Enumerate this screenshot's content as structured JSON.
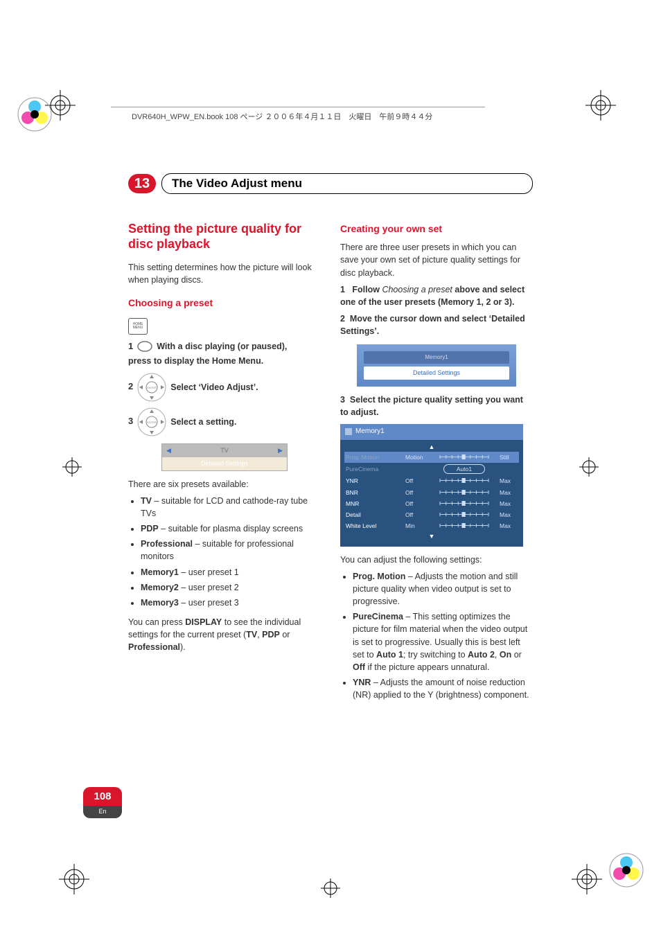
{
  "header_line": "DVR640H_WPW_EN.book  108 ページ  ２００６年４月１１日　火曜日　午前９時４４分",
  "chapter": {
    "number": "13",
    "title": "The Video Adjust menu"
  },
  "left": {
    "h2": "Setting the picture quality for disc playback",
    "intro": "This setting determines how the picture will look when playing discs.",
    "h3": "Choosing a preset",
    "home_icon_top": "HOME",
    "home_icon_bottom": "MENU",
    "step1_num": "1",
    "step1_text": "With a disc playing (or paused),",
    "step1_cont": "press to display the Home Menu.",
    "step2_num": "2",
    "step2_text": "Select ‘Video Adjust’.",
    "step3_num": "3",
    "step3_text": "Select a setting.",
    "nav_center": "ENTER",
    "ui1": {
      "row1": "TV",
      "row2": "Detailed Settings"
    },
    "presets_intro": "There are six presets available:",
    "bullets": [
      {
        "b": "TV",
        "t": " – suitable for LCD and cathode-ray tube TVs"
      },
      {
        "b": "PDP",
        "t": " – suitable for plasma display screens"
      },
      {
        "b": "Professional",
        "t": " – suitable for professional monitors"
      },
      {
        "b": "Memory1",
        "t": " – user preset 1"
      },
      {
        "b": "Memory2",
        "t": " – user preset 2"
      },
      {
        "b": "Memory3",
        "t": " – user preset 3"
      }
    ],
    "outro_a": "You can press ",
    "outro_b": "DISPLAY",
    "outro_c": " to see the individual settings for the current preset (",
    "outro_d": "TV",
    "outro_e": ", ",
    "outro_f": "PDP",
    "outro_g": " or ",
    "outro_h": "Professional",
    "outro_i": ")."
  },
  "right": {
    "h3a": "Creating your own set",
    "p1": "There are three user presets in which you can save your own set of picture quality settings for disc playback.",
    "step1_num": "1",
    "step1_a": "Follow ",
    "step1_b": "Choosing a preset",
    "step1_c": " above and select one of the user presets (Memory 1, 2 or 3).",
    "step2_num": "2",
    "step2_text": "Move the cursor down and select ‘Detailed Settings’.",
    "ui2": {
      "r1": "Memory1",
      "r2": "Detailed Settings"
    },
    "step3_num": "3",
    "step3_text": "Select the picture quality setting you want to adjust.",
    "ui3": {
      "title": "Memory1",
      "rows": [
        {
          "label": "Prog. Motion",
          "left": "Motion",
          "right": "Still",
          "type": "slider",
          "sel": true,
          "dim": true
        },
        {
          "label": "PureCinema",
          "left": "",
          "right": "",
          "type": "pill",
          "pill": "Auto1",
          "dim": true
        },
        {
          "label": "YNR",
          "left": "Off",
          "right": "Max",
          "type": "slider"
        },
        {
          "label": "BNR",
          "left": "Off",
          "right": "Max",
          "type": "slider"
        },
        {
          "label": "MNR",
          "left": "Off",
          "right": "Max",
          "type": "slider"
        },
        {
          "label": "Detail",
          "left": "Off",
          "right": "Max",
          "type": "slider"
        },
        {
          "label": "White Level",
          "left": "Min",
          "right": "Max",
          "type": "slider"
        }
      ]
    },
    "p2": "You can adjust the following settings:",
    "bullets": [
      {
        "b": "Prog. Motion",
        "t": " – Adjusts the motion and still picture quality when video output is set to progressive."
      },
      {
        "b": "PureCinema",
        "segments": [
          " – This setting optimizes the picture for film material when the video output is set to progressive. Usually this is best left set to ",
          {
            "b": "Auto 1"
          },
          "; try switching to ",
          {
            "b": "Auto 2"
          },
          ", ",
          {
            "b": "On"
          },
          " or ",
          {
            "b": "Off"
          },
          " if the picture appears unnatural."
        ]
      },
      {
        "b": "YNR",
        "t": " – Adjusts the amount of noise reduction (NR) applied to the Y (brightness) component."
      }
    ]
  },
  "pagenum": {
    "num": "108",
    "lang": "En"
  }
}
